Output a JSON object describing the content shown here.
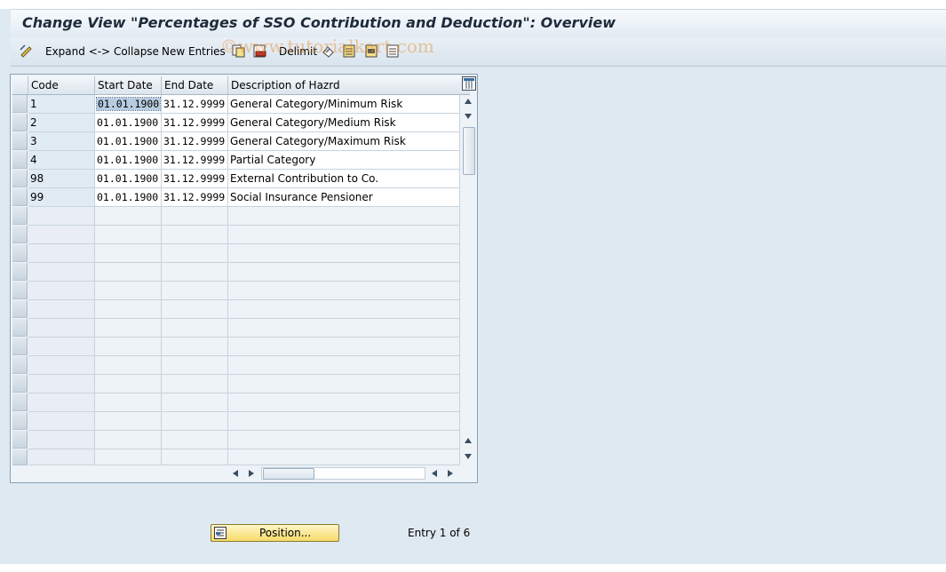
{
  "window": {
    "title": "Change View \"Percentages of SSO Contribution and Deduction\": Overview"
  },
  "toolbar": {
    "expand_collapse_label": "Expand <-> Collapse",
    "new_entries_label": "New Entries",
    "delimit_label": "Delimit"
  },
  "watermark": "©www.tutorialkart.com",
  "table": {
    "columns": [
      "Code",
      "Start Date",
      "End Date",
      "Description of Hazrd"
    ],
    "rows": [
      {
        "code": "1",
        "start": "01.01.1900",
        "end": "31.12.9999",
        "desc": "General Category/Minimum Risk"
      },
      {
        "code": "2",
        "start": "01.01.1900",
        "end": "31.12.9999",
        "desc": "General Category/Medium Risk"
      },
      {
        "code": "3",
        "start": "01.01.1900",
        "end": "31.12.9999",
        "desc": "General Category/Maximum Risk"
      },
      {
        "code": "4",
        "start": "01.01.1900",
        "end": "31.12.9999",
        "desc": "Partial Category"
      },
      {
        "code": "98",
        "start": "01.01.1900",
        "end": "31.12.9999",
        "desc": "External Contribution to Co."
      },
      {
        "code": "99",
        "start": "01.01.1900",
        "end": "31.12.9999",
        "desc": "Social Insurance Pensioner"
      }
    ]
  },
  "footer": {
    "position_label": "Position...",
    "entry_text": "Entry 1 of 6"
  },
  "colors": {
    "background": "#dfe9f1",
    "position_button": "#f7db6a"
  }
}
